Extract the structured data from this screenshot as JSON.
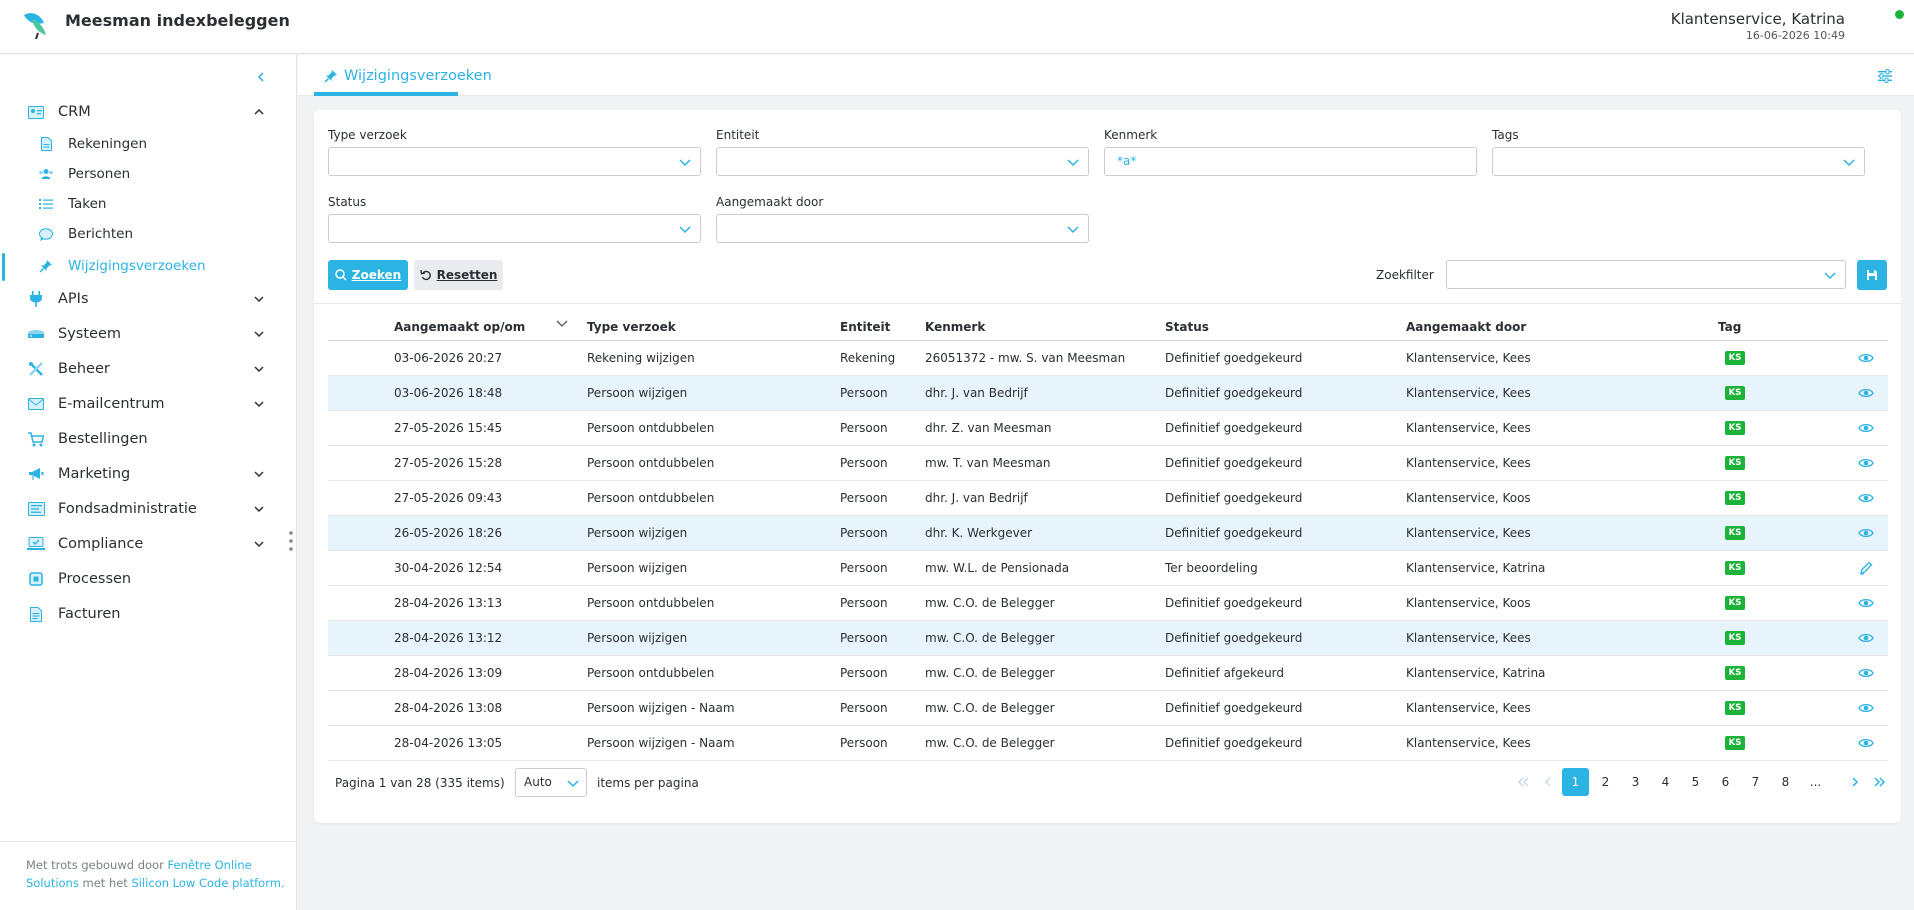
{
  "app": {
    "title": "Meesman indexbeleggen"
  },
  "user": {
    "name": "Klantenservice, Katrina",
    "datetime": "16-06-2026 10:49"
  },
  "sidebar": {
    "items": [
      {
        "label": "CRM",
        "icon": "id-card-icon"
      },
      {
        "label": "APIs",
        "icon": "plug-icon"
      },
      {
        "label": "Systeem",
        "icon": "server-icon"
      },
      {
        "label": "Beheer",
        "icon": "tools-icon"
      },
      {
        "label": "E-mailcentrum",
        "icon": "envelope-icon"
      },
      {
        "label": "Bestellingen",
        "icon": "cart-icon"
      },
      {
        "label": "Marketing",
        "icon": "bullhorn-icon"
      },
      {
        "label": "Fondsadministratie",
        "icon": "ledger-icon"
      },
      {
        "label": "Compliance",
        "icon": "laptop-check-icon"
      },
      {
        "label": "Processen",
        "icon": "process-icon"
      },
      {
        "label": "Facturen",
        "icon": "invoice-icon"
      }
    ],
    "crm_sub": [
      {
        "label": "Rekeningen"
      },
      {
        "label": "Personen"
      },
      {
        "label": "Taken"
      },
      {
        "label": "Berichten"
      },
      {
        "label": "Wijzigingsverzoeken"
      }
    ],
    "footer": {
      "text1": "Met trots gebouwd door ",
      "link1": "Fenêtre Online Solutions",
      "text2": " met het ",
      "link2": "Silicon Low Code platform."
    }
  },
  "tab": {
    "label": "Wijzigingsverzoeken"
  },
  "filters": {
    "type_label": "Type verzoek",
    "entiteit_label": "Entiteit",
    "kenmerk_label": "Kenmerk",
    "kenmerk_value": "*a*",
    "tags_label": "Tags",
    "status_label": "Status",
    "aangemaakt_label": "Aangemaakt door",
    "search_label": "Zoeken",
    "reset_label": "Resetten",
    "zoekfilter_label": "Zoekfilter"
  },
  "table": {
    "headers": [
      "Aangemaakt op/om",
      "Type verzoek",
      "Entiteit",
      "Kenmerk",
      "Status",
      "Aangemaakt door",
      "Tag"
    ],
    "rows": [
      {
        "date": "03-06-2026 20:27",
        "type": "Rekening wijzigen",
        "entity": "Rekening",
        "ref": "26051372 - mw. S. van Meesman",
        "status": "Definitief goedgekeurd",
        "by": "Klantenservice, Kees",
        "tag": "KS",
        "action": "eye-icon",
        "hl": false
      },
      {
        "date": "03-06-2026 18:48",
        "type": "Persoon wijzigen",
        "entity": "Persoon",
        "ref": "dhr. J. van Bedrijf",
        "status": "Definitief goedgekeurd",
        "by": "Klantenservice, Kees",
        "tag": "KS",
        "action": "eye-icon",
        "hl": true
      },
      {
        "date": "27-05-2026 15:45",
        "type": "Persoon ontdubbelen",
        "entity": "Persoon",
        "ref": "dhr. Z. van Meesman",
        "status": "Definitief goedgekeurd",
        "by": "Klantenservice, Kees",
        "tag": "KS",
        "action": "eye-icon",
        "hl": false
      },
      {
        "date": "27-05-2026 15:28",
        "type": "Persoon ontdubbelen",
        "entity": "Persoon",
        "ref": "mw. T. van Meesman",
        "status": "Definitief goedgekeurd",
        "by": "Klantenservice, Kees",
        "tag": "KS",
        "action": "eye-icon",
        "hl": false
      },
      {
        "date": "27-05-2026 09:43",
        "type": "Persoon ontdubbelen",
        "entity": "Persoon",
        "ref": "dhr. J. van Bedrijf",
        "status": "Definitief goedgekeurd",
        "by": "Klantenservice, Koos",
        "tag": "KS",
        "action": "eye-icon",
        "hl": false
      },
      {
        "date": "26-05-2026 18:26",
        "type": "Persoon wijzigen",
        "entity": "Persoon",
        "ref": "dhr. K. Werkgever",
        "status": "Definitief goedgekeurd",
        "by": "Klantenservice, Kees",
        "tag": "KS",
        "action": "eye-icon",
        "hl": true
      },
      {
        "date": "30-04-2026 12:54",
        "type": "Persoon wijzigen",
        "entity": "Persoon",
        "ref": "mw. W.L. de Pensionada",
        "status": "Ter beoordeling",
        "by": "Klantenservice, Katrina",
        "tag": "KS",
        "action": "pencil-icon",
        "hl": false
      },
      {
        "date": "28-04-2026 13:13",
        "type": "Persoon ontdubbelen",
        "entity": "Persoon",
        "ref": "mw. C.O. de Belegger",
        "status": "Definitief goedgekeurd",
        "by": "Klantenservice, Koos",
        "tag": "KS",
        "action": "eye-icon",
        "hl": false
      },
      {
        "date": "28-04-2026 13:12",
        "type": "Persoon wijzigen",
        "entity": "Persoon",
        "ref": "mw. C.O. de Belegger",
        "status": "Definitief goedgekeurd",
        "by": "Klantenservice, Kees",
        "tag": "KS",
        "action": "eye-icon",
        "hl": true
      },
      {
        "date": "28-04-2026 13:09",
        "type": "Persoon ontdubbelen",
        "entity": "Persoon",
        "ref": "mw. C.O. de Belegger",
        "status": "Definitief afgekeurd",
        "by": "Klantenservice, Katrina",
        "tag": "KS",
        "action": "eye-icon",
        "hl": false
      },
      {
        "date": "28-04-2026 13:08",
        "type": "Persoon wijzigen - Naam",
        "entity": "Persoon",
        "ref": "mw. C.O. de Belegger",
        "status": "Definitief goedgekeurd",
        "by": "Klantenservice, Kees",
        "tag": "KS",
        "action": "eye-icon",
        "hl": false
      },
      {
        "date": "28-04-2026 13:05",
        "type": "Persoon wijzigen - Naam",
        "entity": "Persoon",
        "ref": "mw. C.O. de Belegger",
        "status": "Definitief goedgekeurd",
        "by": "Klantenservice, Kees",
        "tag": "KS",
        "action": "eye-icon",
        "hl": false
      }
    ]
  },
  "pagination": {
    "info": "Pagina 1 van 28 (335 items)",
    "per_page": "Auto",
    "per_page_label": "items per pagina",
    "pages": [
      "1",
      "2",
      "3",
      "4",
      "5",
      "6",
      "7",
      "8",
      "..."
    ],
    "current": "1"
  },
  "colors": {
    "accent": "#2bb3e3",
    "tag_green": "#1db33b",
    "row_highlight": "#e8f4fc"
  }
}
